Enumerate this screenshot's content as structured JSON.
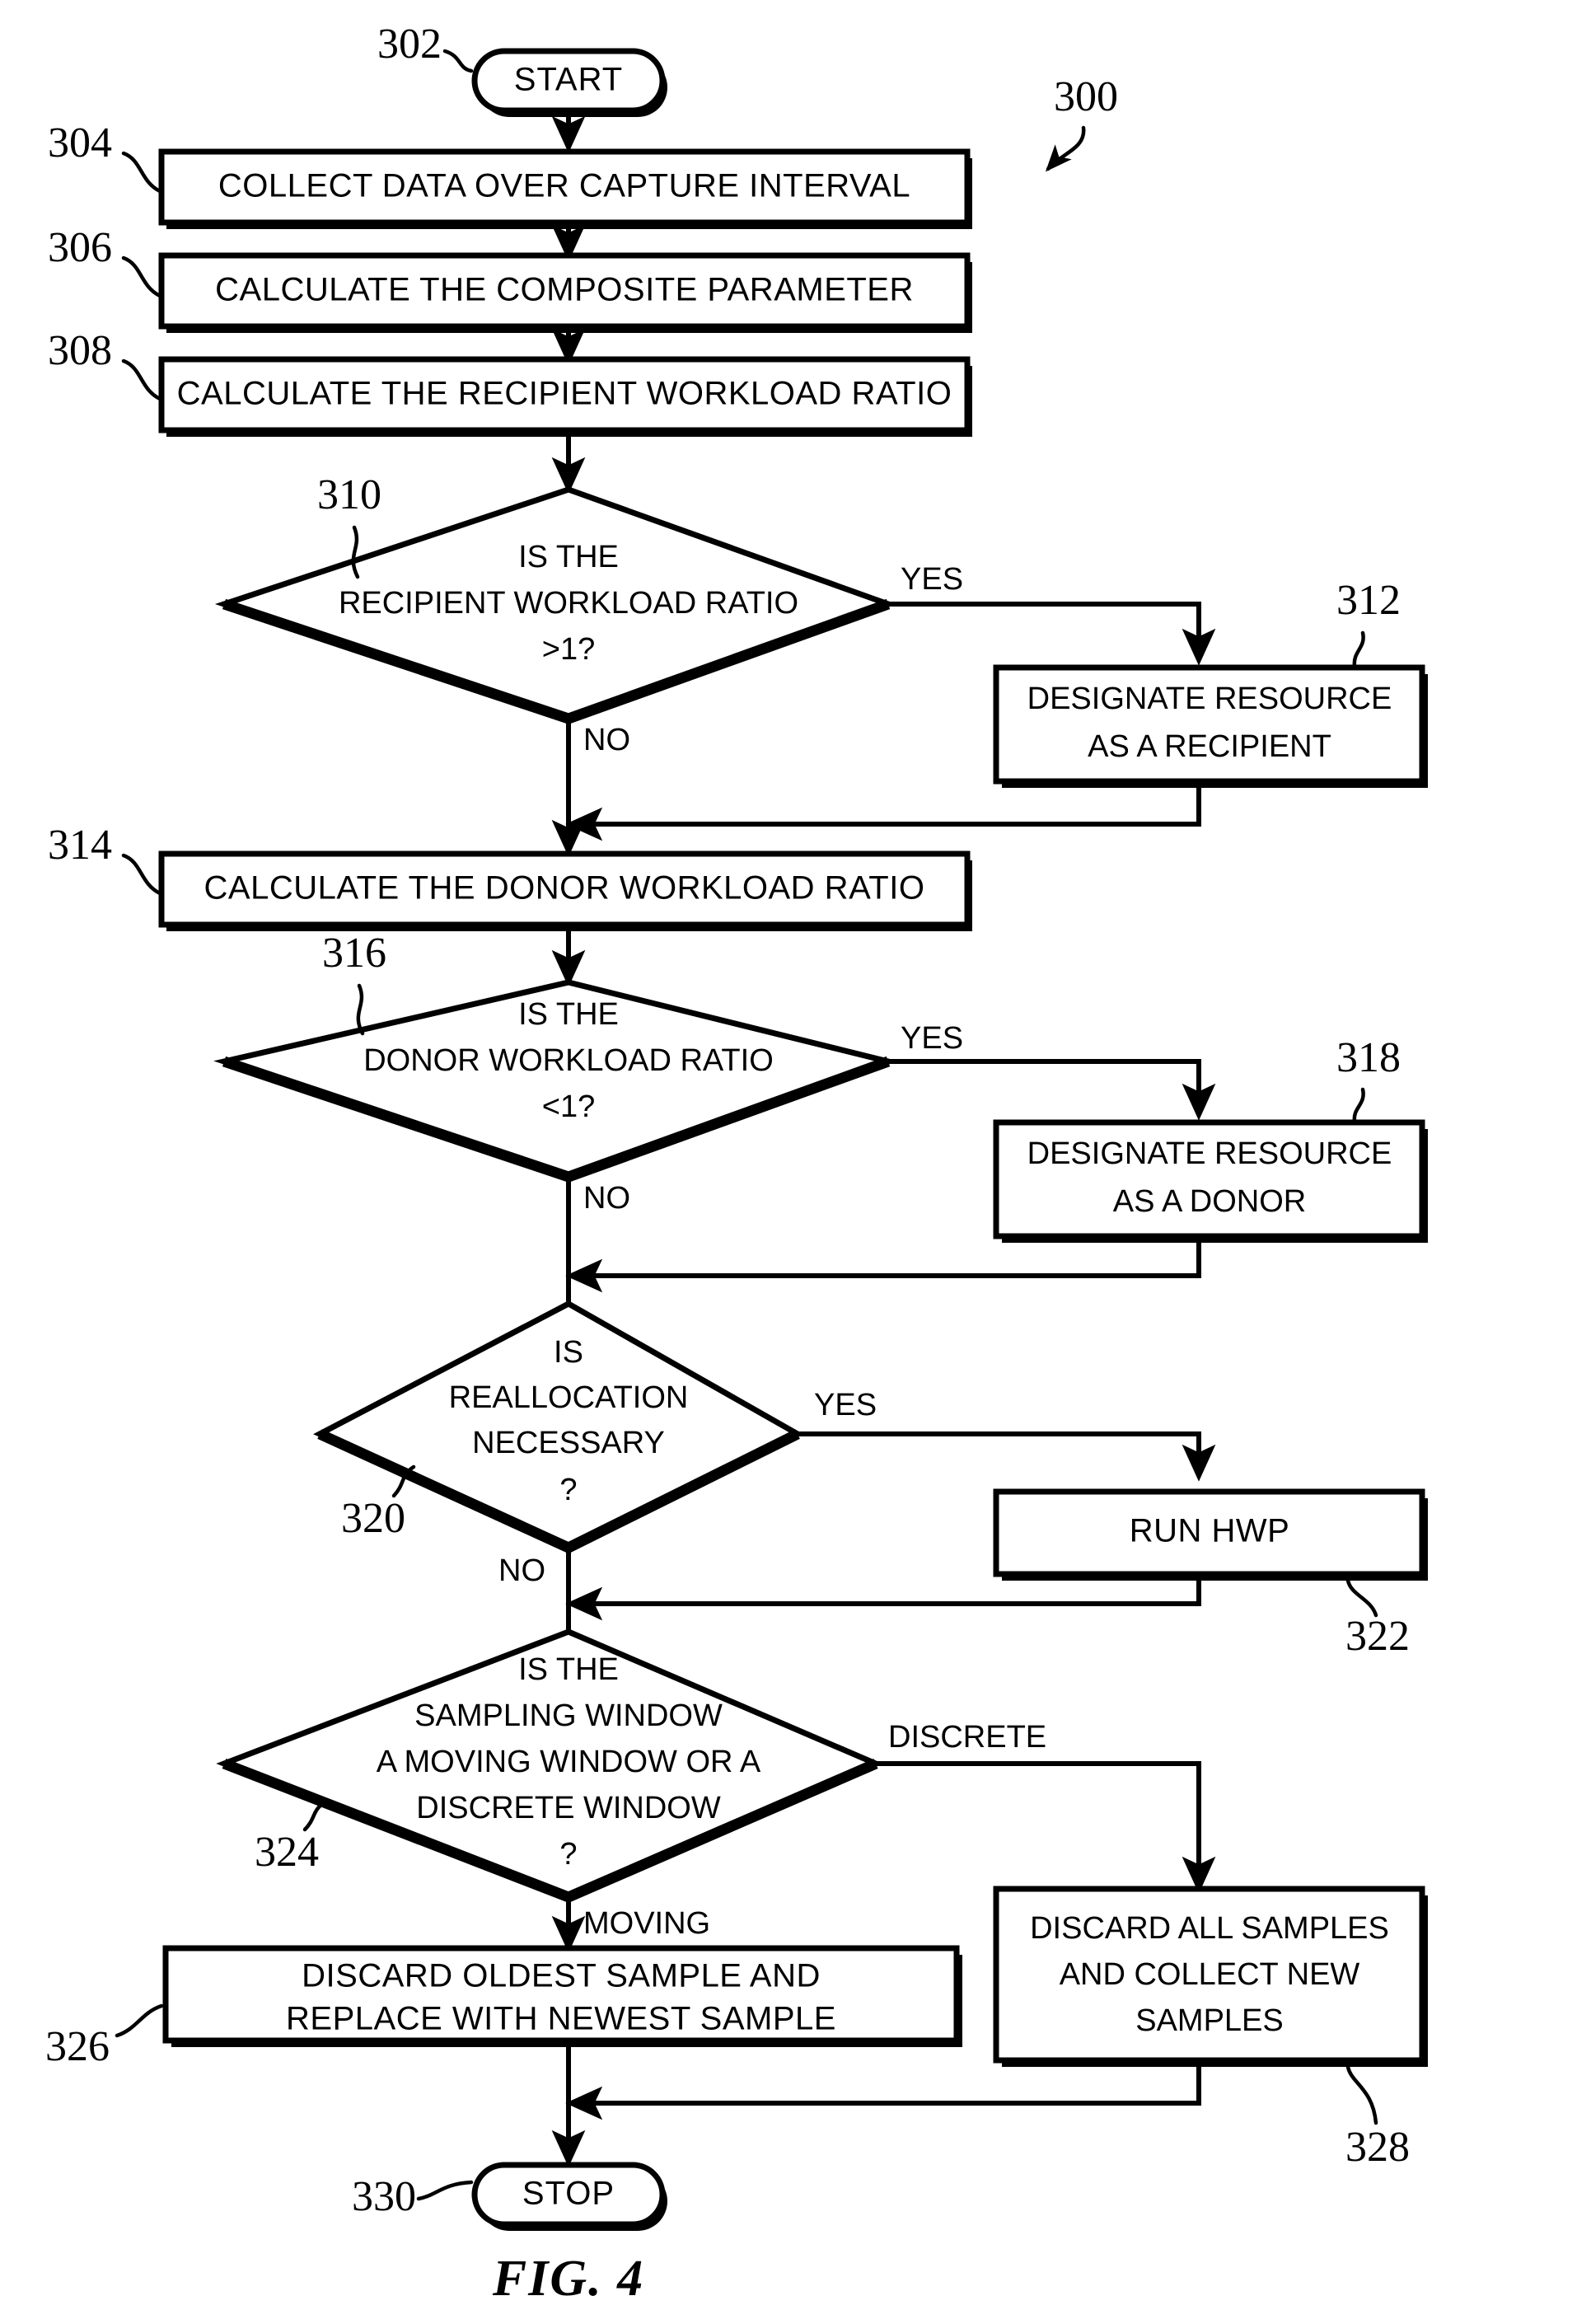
{
  "figure": {
    "caption": "FIG. 4",
    "diagram_ref": "300",
    "type": "flowchart"
  },
  "nodes": [
    {
      "ref": "302",
      "kind": "terminal",
      "label": "START"
    },
    {
      "ref": "304",
      "kind": "process",
      "label": "COLLECT DATA OVER CAPTURE INTERVAL"
    },
    {
      "ref": "306",
      "kind": "process",
      "label": "CALCULATE THE COMPOSITE PARAMETER"
    },
    {
      "ref": "308",
      "kind": "process",
      "label": "CALCULATE THE RECIPIENT WORKLOAD RATIO"
    },
    {
      "ref": "310",
      "kind": "decision",
      "lines": [
        "IS THE",
        "RECIPIENT WORKLOAD RATIO",
        ">1?"
      ]
    },
    {
      "ref": "312",
      "kind": "process",
      "lines": [
        "DESIGNATE RESOURCE",
        "AS A RECIPIENT"
      ]
    },
    {
      "ref": "314",
      "kind": "process",
      "label": "CALCULATE THE DONOR WORKLOAD RATIO"
    },
    {
      "ref": "316",
      "kind": "decision",
      "lines": [
        "IS THE",
        "DONOR WORKLOAD RATIO",
        "<1?"
      ]
    },
    {
      "ref": "318",
      "kind": "process",
      "lines": [
        "DESIGNATE RESOURCE",
        "AS A DONOR"
      ]
    },
    {
      "ref": "320",
      "kind": "decision",
      "lines": [
        "IS",
        "REALLOCATION",
        "NECESSARY",
        "?"
      ]
    },
    {
      "ref": "322",
      "kind": "process",
      "label": "RUN HWP"
    },
    {
      "ref": "324",
      "kind": "decision",
      "lines": [
        "IS THE",
        "SAMPLING WINDOW",
        "A MOVING WINDOW OR A",
        "DISCRETE WINDOW",
        "?"
      ]
    },
    {
      "ref": "326",
      "kind": "process",
      "lines": [
        "DISCARD OLDEST SAMPLE AND",
        "REPLACE WITH NEWEST SAMPLE"
      ]
    },
    {
      "ref": "328",
      "kind": "process",
      "lines": [
        "DISCARD ALL SAMPLES",
        "AND COLLECT NEW",
        "SAMPLES"
      ]
    },
    {
      "ref": "330",
      "kind": "terminal",
      "label": "STOP"
    }
  ],
  "edge_labels": {
    "d310_yes": "YES",
    "d310_no": "NO",
    "d316_yes": "YES",
    "d316_no": "NO",
    "d320_yes": "YES",
    "d320_no": "NO",
    "d324_discrete": "DISCRETE",
    "d324_moving": "MOVING"
  },
  "colors": {
    "ink": "#000000",
    "paper": "#ffffff"
  }
}
